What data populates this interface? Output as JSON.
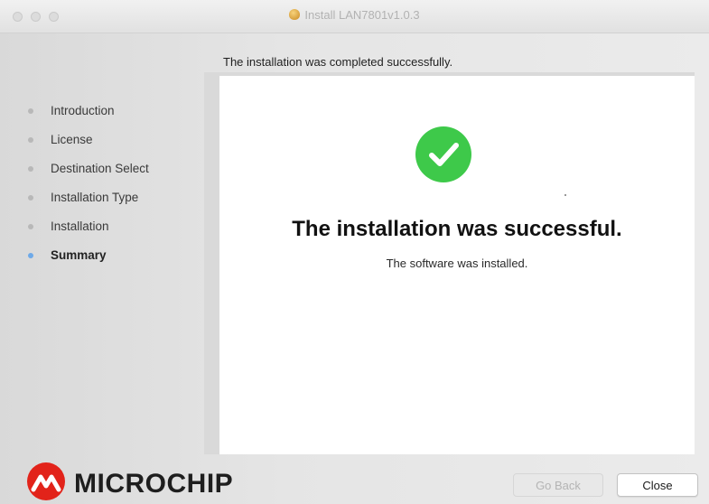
{
  "window": {
    "title": "Install LAN7801v1.0.3"
  },
  "header": {
    "status_text": "The installation was completed successfully."
  },
  "sidebar": {
    "steps": [
      {
        "label": "Introduction",
        "active": false
      },
      {
        "label": "License",
        "active": false
      },
      {
        "label": "Destination Select",
        "active": false
      },
      {
        "label": "Installation Type",
        "active": false
      },
      {
        "label": "Installation",
        "active": false
      },
      {
        "label": "Summary",
        "active": true
      }
    ]
  },
  "content": {
    "icon": "check-circle-icon",
    "title": "The installation was successful.",
    "subtitle": "The software was installed."
  },
  "logo": {
    "text": "MICROCHIP"
  },
  "buttons": {
    "back_label": "Go Back",
    "close_label": "Close"
  },
  "colors": {
    "success_green": "#3ec94a",
    "active_step_dot": "#6ea9e8",
    "brand_red": "#e2231a"
  }
}
